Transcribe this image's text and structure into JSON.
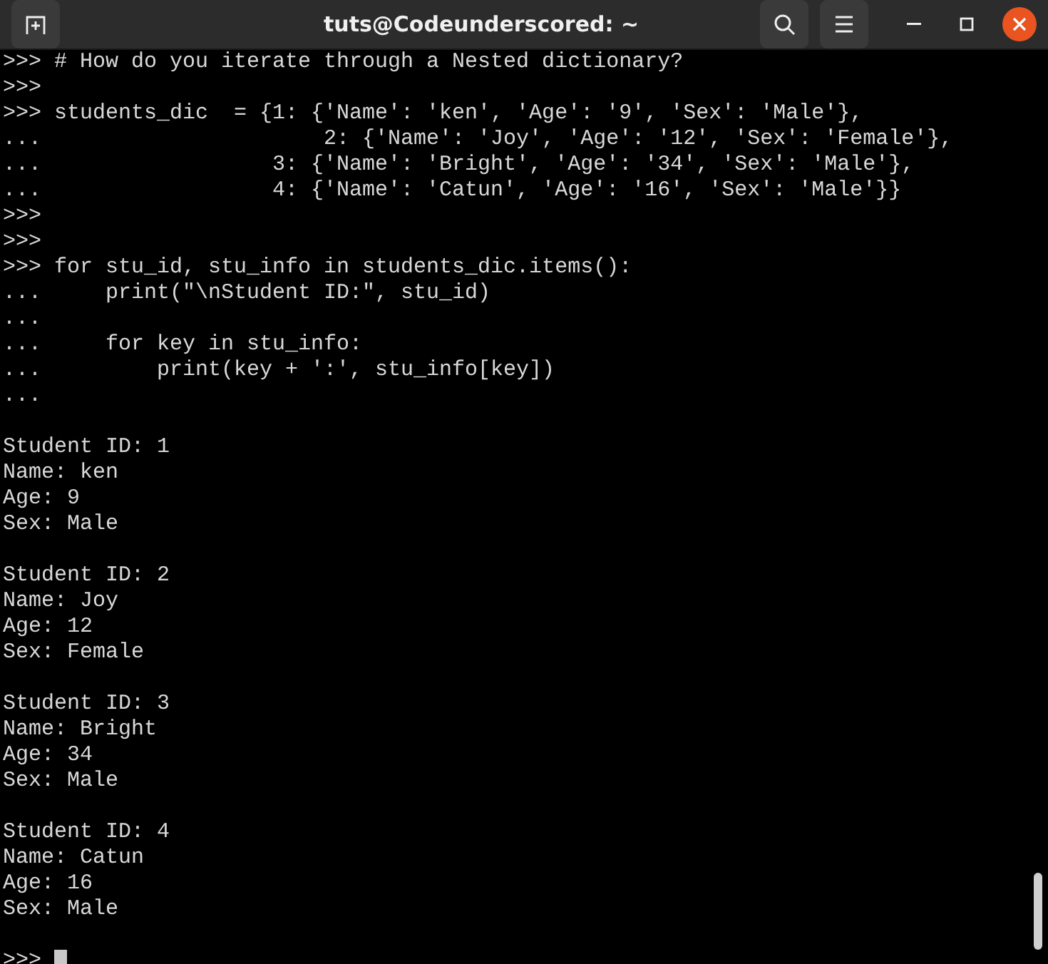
{
  "window": {
    "title": "tuts@Codeunderscored: ~"
  },
  "terminal": {
    "cursor": true,
    "blocks": [
      [
        ">>> # How do you iterate through a Nested dictionary?",
        ">>>",
        ">>> students_dic  = {1: {'Name': 'ken', 'Age': '9', 'Sex': 'Male'},",
        "...                      2: {'Name': 'Joy', 'Age': '12', 'Sex': 'Female'},",
        "...                  3: {'Name': 'Bright', 'Age': '34', 'Sex': 'Male'},",
        "...                  4: {'Name': 'Catun', 'Age': '16', 'Sex': 'Male'}}",
        ">>>",
        ">>>",
        ">>> for stu_id, stu_info in students_dic.items():",
        "...     print(\"\\nStudent ID:\", stu_id)",
        "...",
        "...     for key in stu_info:",
        "...         print(key + ':', stu_info[key])",
        "..."
      ],
      [
        "Student ID: 1",
        "Name: ken",
        "Age: 9",
        "Sex: Male"
      ],
      [
        "Student ID: 2",
        "Name: Joy",
        "Age: 12",
        "Sex: Female"
      ],
      [
        "Student ID: 3",
        "Name: Bright",
        "Age: 34",
        "Sex: Male"
      ],
      [
        "Student ID: 4",
        "Name: Catun",
        "Age: 16",
        "Sex: Male"
      ],
      [
        ">>> "
      ]
    ]
  }
}
